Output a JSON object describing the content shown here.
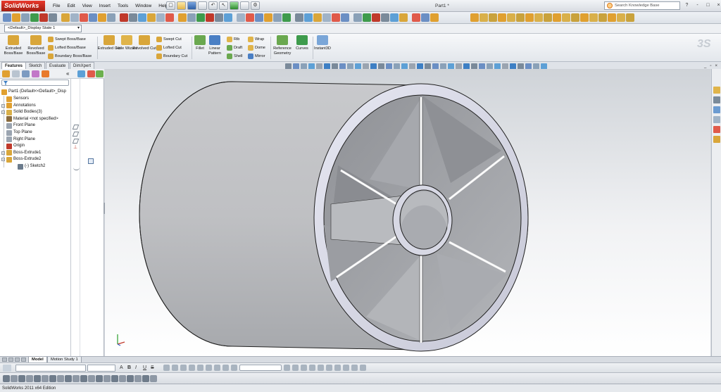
{
  "app": {
    "name": "SolidWorks",
    "doc_title": "Part1 *",
    "status": "SolidWorks 2011 x64 Edition"
  },
  "menus": [
    "File",
    "Edit",
    "View",
    "Insert",
    "Tools",
    "Window",
    "Help"
  ],
  "search": {
    "placeholder": "Search Knowledge Base"
  },
  "window_controls": {
    "help": "?",
    "minimize": "-",
    "restore": "□",
    "close": "×"
  },
  "config": {
    "value": "<Default>_Display State 1"
  },
  "command_manager": {
    "big_buttons": [
      {
        "label": "Extruded Boss/Base",
        "color": "#d9a63a"
      },
      {
        "label": "Revolved Boss/Base",
        "color": "#d9a63a"
      },
      {
        "label": "Extruded Cut",
        "color": "#d9a63a"
      },
      {
        "label": "Hole Wizard",
        "color": "#e0b44a"
      },
      {
        "label": "Revolved Cut",
        "color": "#d9a63a"
      },
      {
        "label": "Fillet",
        "color": "#6aa84f"
      },
      {
        "label": "Linear Pattern",
        "color": "#4a7fc4"
      },
      {
        "label": "Reference Geometry",
        "color": "#6aa84f"
      },
      {
        "label": "Curves",
        "color": "#3e9b4c"
      },
      {
        "label": "Instant3D",
        "color": "#7aa6d8"
      }
    ],
    "small_buttons": [
      {
        "label": "Swept Boss/Base",
        "color": "#d9a63a"
      },
      {
        "label": "Lofted Boss/Base",
        "color": "#d9a63a"
      },
      {
        "label": "Boundary Boss/Base",
        "color": "#d9a63a"
      },
      {
        "label": "Swept Cut",
        "color": "#d9a63a"
      },
      {
        "label": "Lofted Cut",
        "color": "#d9a63a"
      },
      {
        "label": "Boundary Cut",
        "color": "#d9a63a"
      },
      {
        "label": "Rib",
        "color": "#e0b44a"
      },
      {
        "label": "Draft",
        "color": "#6aa84f"
      },
      {
        "label": "Shell",
        "color": "#6aa84f"
      },
      {
        "label": "Wrap",
        "color": "#e0b44a"
      },
      {
        "label": "Dome",
        "color": "#e0b44a"
      },
      {
        "label": "Mirror",
        "color": "#4a7fc4"
      }
    ],
    "tabs": [
      "Features",
      "Sketch",
      "Evaluate",
      "DimXpert"
    ]
  },
  "tree": {
    "root": "Part1  (Default<<Default>_Disp",
    "items": [
      {
        "label": "Sensors",
        "icon": "sensor-icon",
        "color": "#e0a030"
      },
      {
        "label": "Annotations",
        "icon": "annotations-icon",
        "color": "#e0a030"
      },
      {
        "label": "Solid Bodies(3)",
        "icon": "solid-bodies-icon",
        "color": "#d9b04a"
      },
      {
        "label": "Material <not specified>",
        "icon": "material-icon",
        "color": "#8a6b3d"
      },
      {
        "label": "Front Plane",
        "icon": "plane-icon",
        "color": "#9aa4b0"
      },
      {
        "label": "Top Plane",
        "icon": "plane-icon",
        "color": "#9aa4b0"
      },
      {
        "label": "Right Plane",
        "icon": "plane-icon",
        "color": "#9aa4b0"
      },
      {
        "label": "Origin",
        "icon": "origin-icon",
        "color": "#c0392b"
      },
      {
        "label": "Boss-Extrude1",
        "icon": "extrude-icon",
        "color": "#d9a63a"
      },
      {
        "label": "Boss-Extrude2",
        "icon": "extrude-icon",
        "color": "#d9a63a"
      },
      {
        "label": "(-) Sketch2",
        "icon": "sketch-icon",
        "color": "#6b7b8c"
      }
    ]
  },
  "bottom_tabs": [
    "Model",
    "Motion Study 1"
  ],
  "format": {
    "bold": "A",
    "b": "B",
    "i": "I",
    "u": "U",
    "s": "S",
    "size": "A"
  },
  "colors": {
    "accent": "#c0392b",
    "viewport_top": "#cfd3d8",
    "model_gray": "#b9bbbe"
  }
}
